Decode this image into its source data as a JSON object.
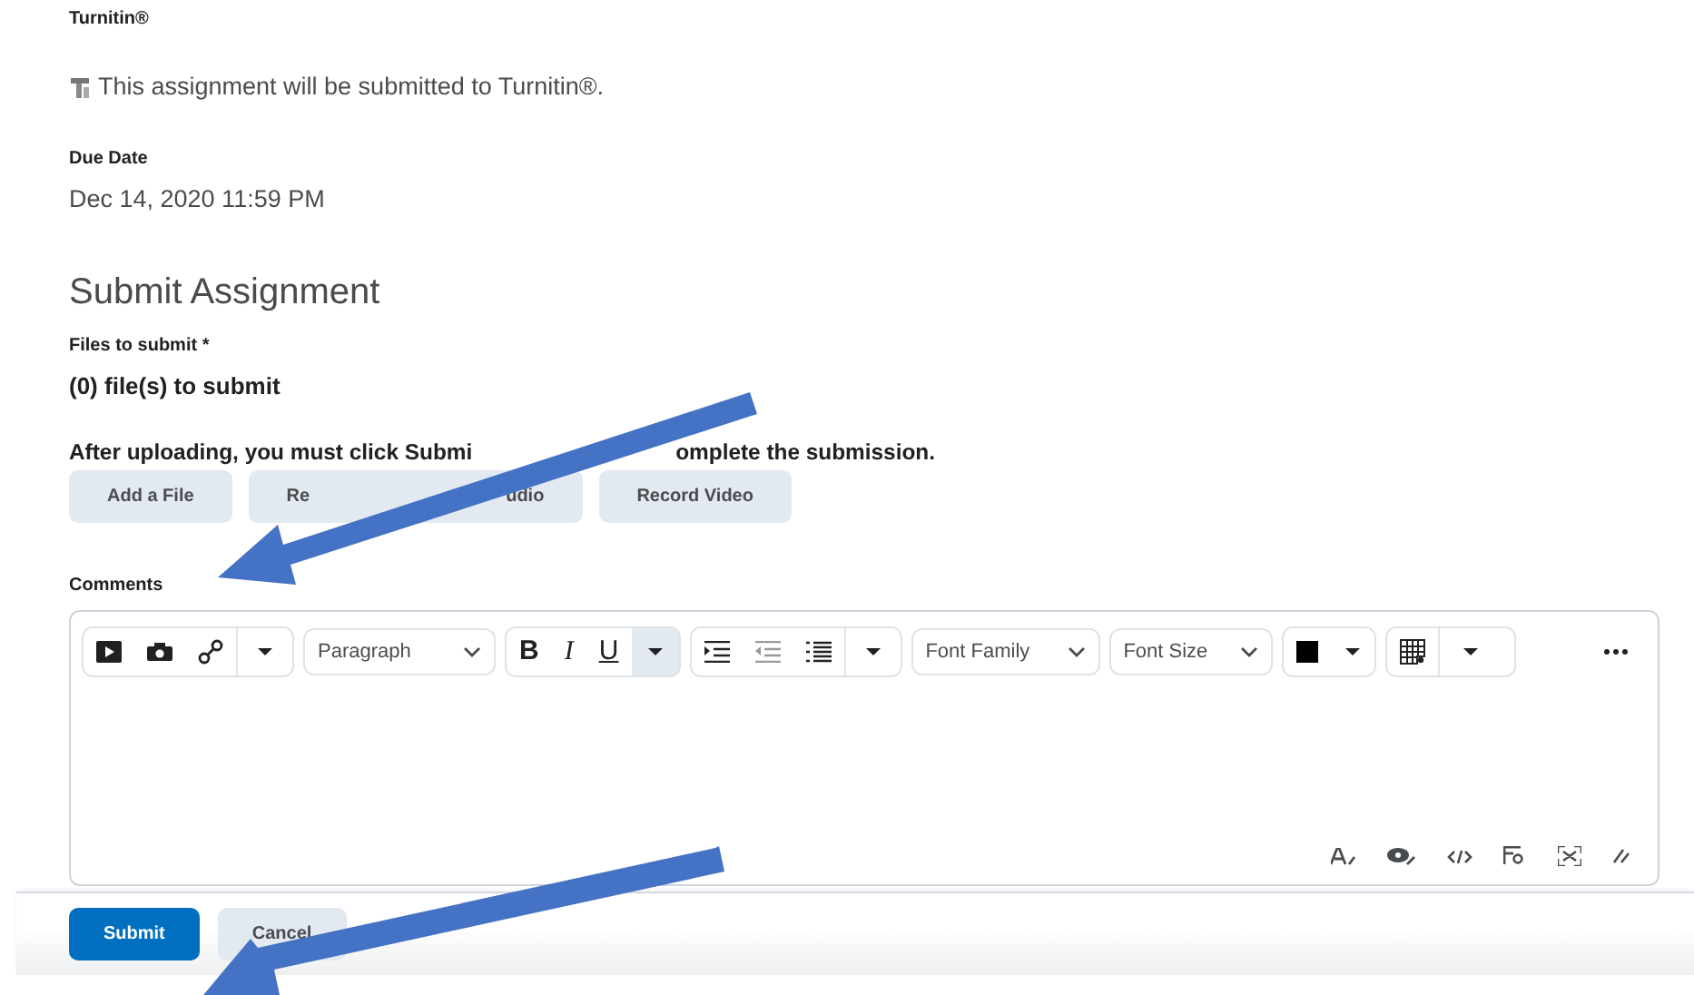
{
  "turnitin": {
    "label": "Turnitin®",
    "notice": "This assignment will be submitted to Turnitin®."
  },
  "due_date": {
    "label": "Due Date",
    "value": "Dec 14, 2020 11:59 PM"
  },
  "heading": "Submit Assignment",
  "files": {
    "label": "Files to submit *",
    "count": "(0) file(s) to submit",
    "instruction_parts": [
      "After uploading, you must click Submi",
      "omplete the submission."
    ]
  },
  "upload_buttons": [
    [
      "Add a File"
    ],
    [
      "Re",
      "udio"
    ],
    [
      "Record Video"
    ]
  ],
  "comments": {
    "label": "Comments",
    "toolbar": {
      "block_format": "Paragraph",
      "format_buttons": [
        "B",
        "I",
        "U"
      ],
      "format_menu_highlighted": true,
      "font_family": "Font Family",
      "font_size": "Font Size"
    }
  },
  "footer_buttons": [
    {
      "label": "Submit",
      "kind": "primary"
    },
    {
      "label": "Cancel",
      "kind": "secondary"
    }
  ]
}
